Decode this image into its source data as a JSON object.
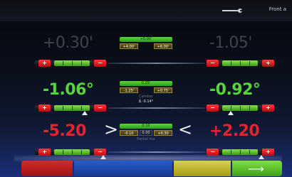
{
  "topbar": {
    "left_text": "",
    "mid_text": "",
    "right_text": "Front a"
  },
  "rows": [
    {
      "id": "caster",
      "left_value": "+0.30'",
      "right_value": "-1.05'",
      "center": {
        "target": "+5.00'",
        "min": "+4.00'",
        "max": "+6.00'",
        "mid": "",
        "label": "",
        "extra": ""
      },
      "left_marker_pct": 50,
      "right_marker_pct": 50,
      "text_color": "#3f434b"
    },
    {
      "id": "camber",
      "left_value": "-1.06°",
      "right_value": "-0.92°",
      "center": {
        "target": "0.25'",
        "min": "-1.25'",
        "max": "+0.75'",
        "mid": "",
        "label": "Camber",
        "extra": "Δ -0.14°"
      },
      "left_marker_pct": 70,
      "right_marker_pct": 35,
      "text_color": "#55d63c"
    },
    {
      "id": "partial-toe",
      "left_value": "-5.20",
      "right_value": "+2.20",
      "center": {
        "target": "0.10",
        "min": "-0.10",
        "max": "+0.30",
        "mid": "0.00",
        "label": "Partial toe",
        "extra": ""
      },
      "left_marker_pct": 95,
      "right_marker_pct": 80,
      "text_color": "#e4232c"
    }
  ],
  "buttons": {
    "minus": "−",
    "plus": "+"
  },
  "bottom_nav": {
    "arrow_label": "⟶"
  },
  "icons": {
    "wrench": "wrench-icon",
    "car": "car-icon",
    "next": "arrow-right-icon",
    "chevron_left": "chevron-right-icon",
    "chevron_right": "chevron-left-icon"
  }
}
